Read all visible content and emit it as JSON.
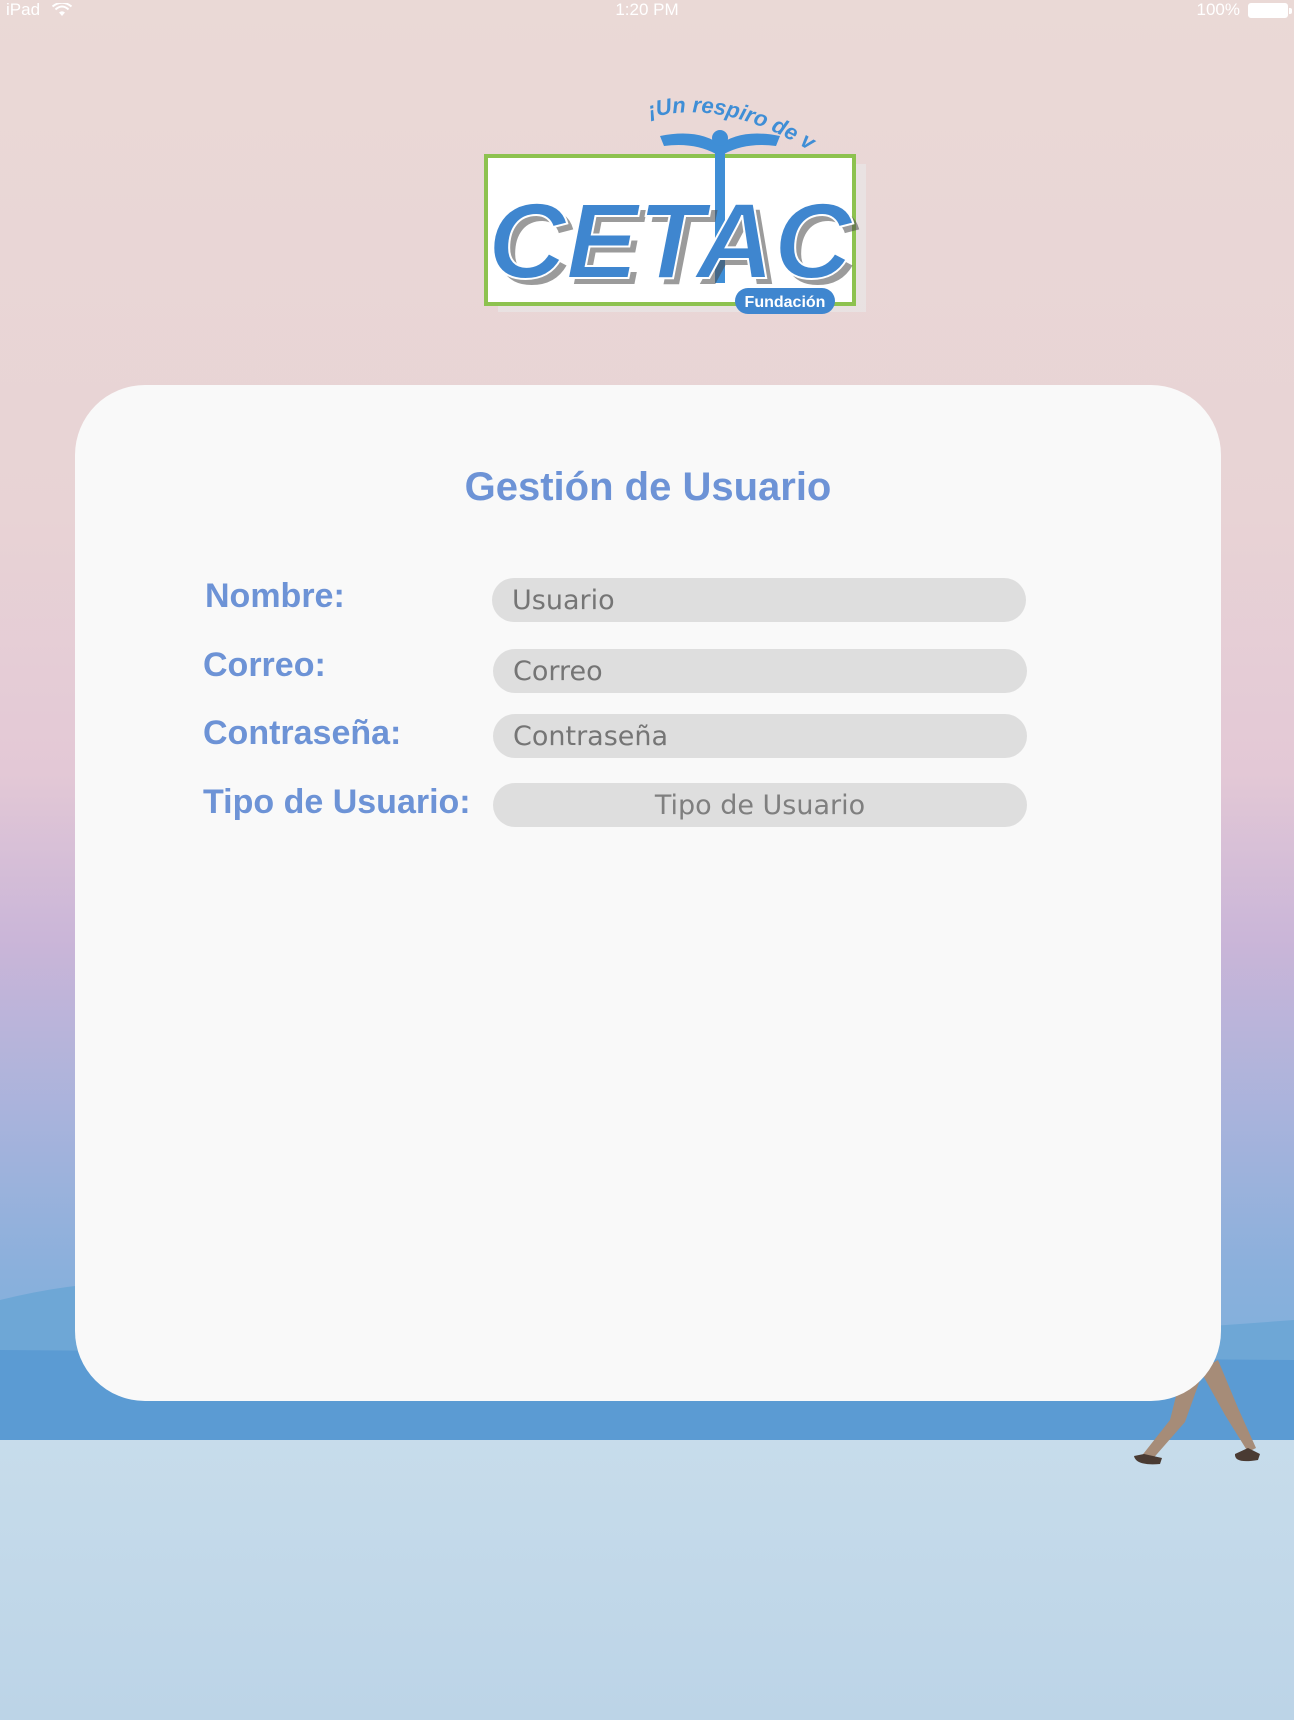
{
  "status_bar": {
    "device": "iPad",
    "time": "1:20 PM",
    "battery": "100%"
  },
  "logo": {
    "tagline": "¡Un respiro de vida!",
    "name": "CETAC",
    "sub": "Fundación"
  },
  "form": {
    "title": "Gestión de Usuario",
    "fields": [
      {
        "label": "Nombre:",
        "placeholder": "Usuario"
      },
      {
        "label": "Correo:",
        "placeholder": "Correo"
      },
      {
        "label": "Contraseña:",
        "placeholder": "Contraseña"
      },
      {
        "label": "Tipo de Usuario:",
        "placeholder": "Tipo de Usuario"
      }
    ]
  }
}
